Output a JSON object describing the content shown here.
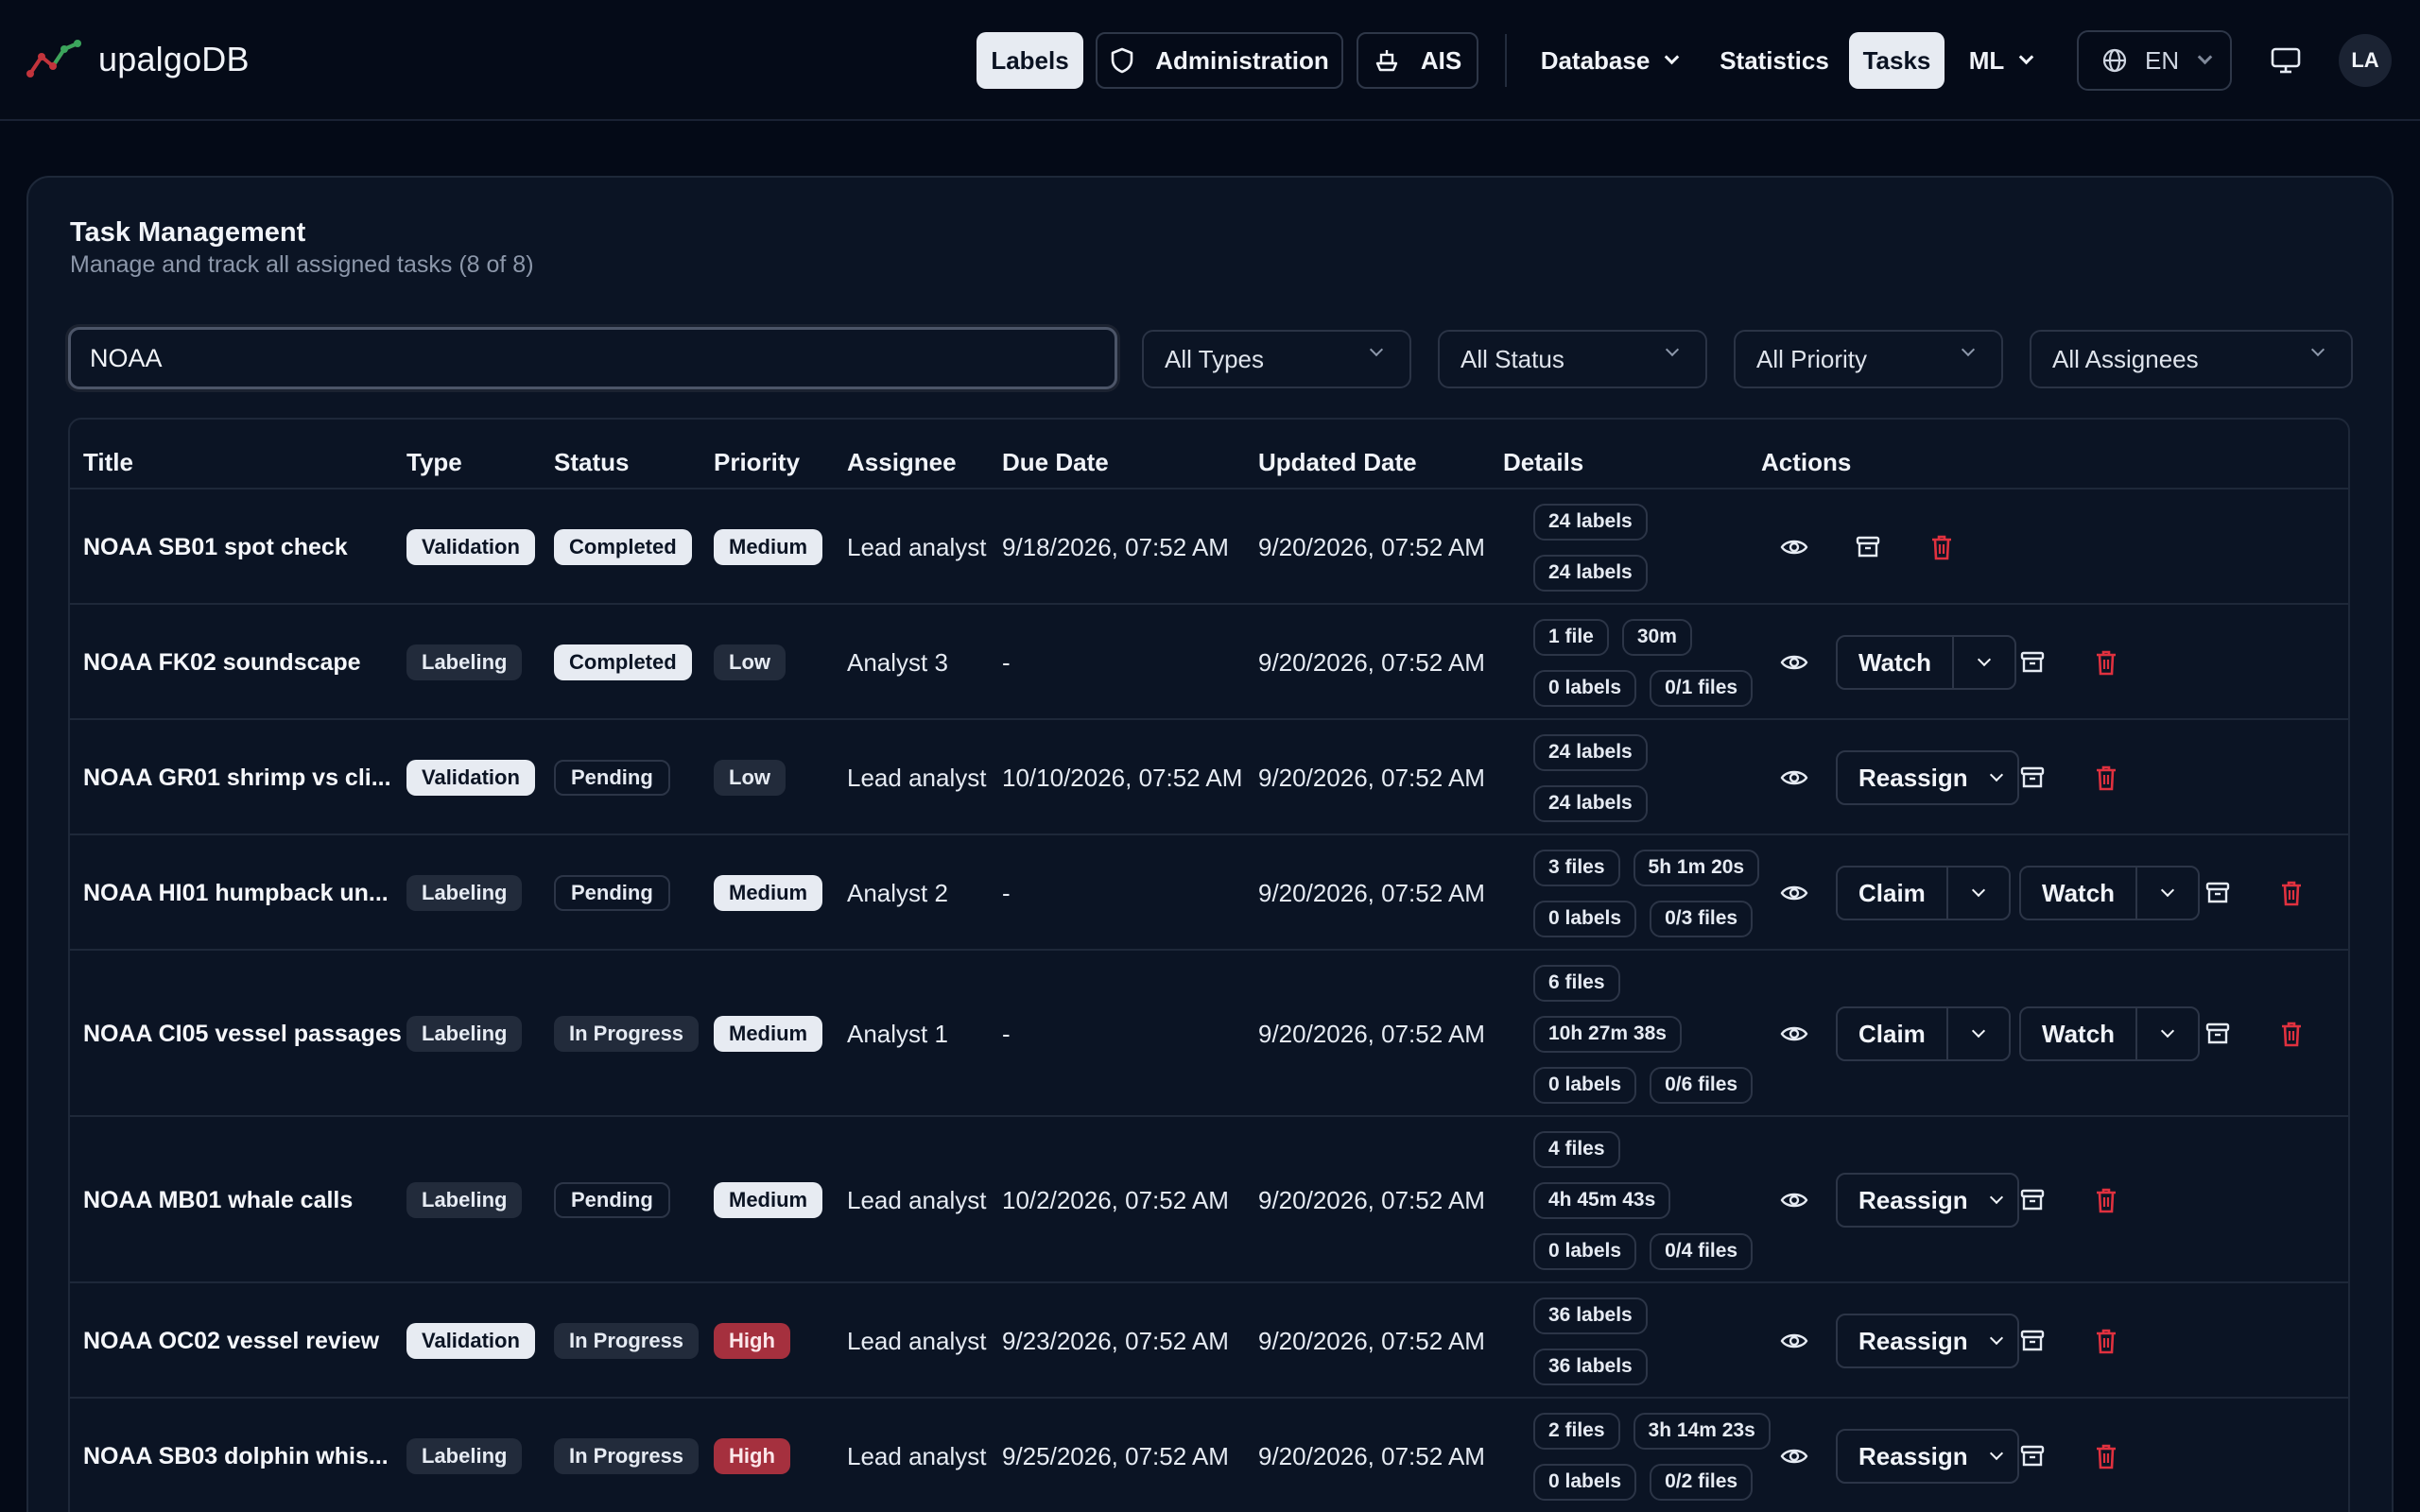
{
  "app": {
    "name": "upalgoDB"
  },
  "nav": {
    "labels": "Labels",
    "administration": "Administration",
    "ais": "AIS",
    "database": "Database",
    "statistics": "Statistics",
    "tasks": "Tasks",
    "ml": "ML",
    "language": "EN",
    "avatar_initials": "LA"
  },
  "page": {
    "title": "Task Management",
    "subtitle": "Manage and track all assigned tasks (8 of 8)"
  },
  "search": {
    "value": "NOAA"
  },
  "filters": {
    "types": "All Types",
    "status": "All Status",
    "priority": "All Priority",
    "assignees": "All Assignees"
  },
  "columns": {
    "title": "Title",
    "type": "Type",
    "status": "Status",
    "priority": "Priority",
    "assignee": "Assignee",
    "due": "Due Date",
    "updated": "Updated Date",
    "details": "Details",
    "actions": "Actions"
  },
  "rows": [
    {
      "title": "NOAA SB01 spot check",
      "type": "Validation",
      "status": "Completed",
      "priority": "Medium",
      "assignee": "Lead analyst",
      "due": "9/18/2026, 07:52 AM",
      "updated": "9/20/2026, 07:52 AM",
      "details": [
        [
          "24 labels"
        ],
        [
          "24 labels"
        ]
      ]
    },
    {
      "title": "NOAA FK02 soundscape",
      "type": "Labeling",
      "status": "Completed",
      "priority": "Low",
      "assignee": "Analyst 3",
      "due": "-",
      "updated": "9/20/2026, 07:52 AM",
      "details": [
        [
          "1 file",
          "30m"
        ],
        [
          "0 labels",
          "0/1 files"
        ]
      ],
      "btn1": "Watch"
    },
    {
      "title": "NOAA GR01 shrimp vs cli...",
      "type": "Validation",
      "status": "Pending",
      "priority": "Low",
      "assignee": "Lead analyst",
      "due": "10/10/2026, 07:52 AM",
      "updated": "9/20/2026, 07:52 AM",
      "details": [
        [
          "24 labels"
        ],
        [
          "24 labels"
        ]
      ],
      "btn1": "Reassign"
    },
    {
      "title": "NOAA HI01 humpback un...",
      "type": "Labeling",
      "status": "Pending",
      "priority": "Medium",
      "assignee": "Analyst 2",
      "due": "-",
      "updated": "9/20/2026, 07:52 AM",
      "details": [
        [
          "3 files",
          "5h 1m 20s"
        ],
        [
          "0 labels",
          "0/3 files"
        ]
      ],
      "btn1": "Claim",
      "btn2": "Watch"
    },
    {
      "title": "NOAA CI05 vessel passages",
      "type": "Labeling",
      "status": "In Progress",
      "priority": "Medium",
      "assignee": "Analyst 1",
      "due": "-",
      "updated": "9/20/2026, 07:52 AM",
      "details": [
        [
          "6 files"
        ],
        [
          "10h 27m 38s"
        ],
        [
          "0 labels",
          "0/6 files"
        ]
      ],
      "btn1": "Claim",
      "btn2": "Watch"
    },
    {
      "title": "NOAA MB01 whale calls",
      "type": "Labeling",
      "status": "Pending",
      "priority": "Medium",
      "assignee": "Lead analyst",
      "due": "10/2/2026, 07:52 AM",
      "updated": "9/20/2026, 07:52 AM",
      "details": [
        [
          "4 files"
        ],
        [
          "4h 45m 43s"
        ],
        [
          "0 labels",
          "0/4 files"
        ]
      ],
      "btn1": "Reassign"
    },
    {
      "title": "NOAA OC02 vessel review",
      "type": "Validation",
      "status": "In Progress",
      "priority": "High",
      "assignee": "Lead analyst",
      "due": "9/23/2026, 07:52 AM",
      "updated": "9/20/2026, 07:52 AM",
      "details": [
        [
          "36 labels"
        ],
        [
          "36 labels"
        ]
      ],
      "btn1": "Reassign"
    },
    {
      "title": "NOAA SB03 dolphin whis...",
      "type": "Labeling",
      "status": "In Progress",
      "priority": "High",
      "assignee": "Lead analyst",
      "due": "9/25/2026, 07:52 AM",
      "updated": "9/20/2026, 07:52 AM",
      "details": [
        [
          "2 files",
          "3h 14m 23s"
        ],
        [
          "0 labels",
          "0/2 files"
        ]
      ],
      "btn1": "Reassign"
    }
  ],
  "colors": {
    "accent_light": "#e7ebf2",
    "high_priority": "#a5303e",
    "delete": "#e0313f"
  }
}
